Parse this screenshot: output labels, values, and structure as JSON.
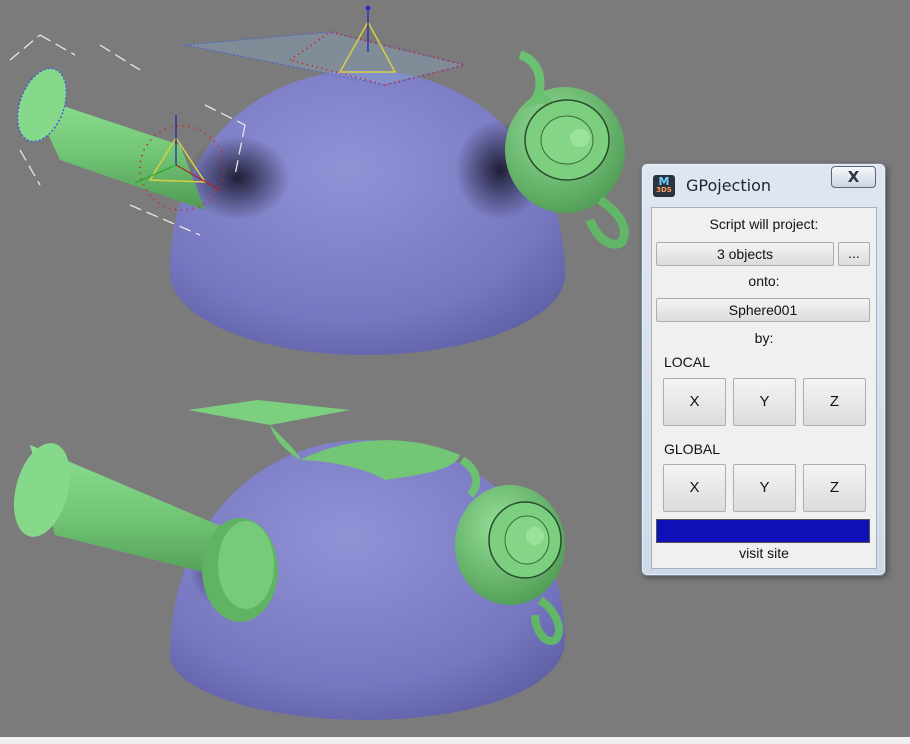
{
  "dialog": {
    "logo_line1": "M",
    "logo_line2": "3DS",
    "title": "GPojection",
    "close_label": "X",
    "script_will_project_label": "Script will project:",
    "objects_button": "3 objects",
    "browse_button": "...",
    "onto_label": "onto:",
    "target_button": "Sphere001",
    "by_label": "by:",
    "local_label": "LOCAL",
    "local_axes": [
      "X",
      "Y",
      "Z"
    ],
    "global_label": "GLOBAL",
    "global_axes": [
      "X",
      "Y",
      "Z"
    ],
    "progress_fraction": 1.0,
    "visit_link": "visit site"
  },
  "colors": {
    "viewport_bg": "#7b7b7b",
    "sphere": "#7e80c6",
    "object_green": "#7ccf7f",
    "progress": "#1010b8"
  }
}
